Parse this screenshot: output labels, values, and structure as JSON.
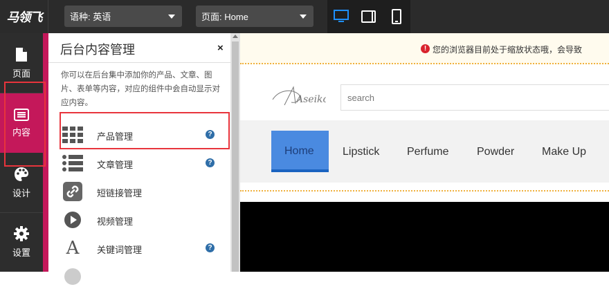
{
  "topbar": {
    "logo_text": "马领飞",
    "language_select": "语种: 英语",
    "page_select": "页面: Home",
    "devices": [
      "desktop-icon",
      "tablet-icon",
      "mobile-icon"
    ],
    "active_device": "desktop",
    "accent": "#1e90ff"
  },
  "leftnav": {
    "items": [
      {
        "label": "页面",
        "icon": "file-icon"
      },
      {
        "label": "内容",
        "icon": "list-icon",
        "active": true
      },
      {
        "label": "设计",
        "icon": "palette-icon"
      },
      {
        "label": "设置",
        "icon": "gear-icon"
      }
    ],
    "active_color": "#c4185a"
  },
  "panel": {
    "title": "后台内容管理",
    "close": "×",
    "description": "你可以在后台集中添加你的产品、文章、图片、表单等内容，对应的组件中会自动显示对应内容。",
    "items": [
      {
        "label": "产品管理",
        "icon": "grid-icon",
        "help": "?"
      },
      {
        "label": "文章管理",
        "icon": "list-icon",
        "help": "?"
      },
      {
        "label": "短链接管理",
        "icon": "link-icon"
      },
      {
        "label": "视频管理",
        "icon": "play-icon"
      },
      {
        "label": "关键词管理",
        "icon": "letter-a-icon",
        "letter": "A",
        "help": "?"
      }
    ]
  },
  "preview": {
    "notice": "您的浏览器目前处于缩放状态哦，会导致",
    "notice_icon": "!",
    "logo_text": "Aseiko",
    "search_placeholder": "search",
    "nav": [
      "Home",
      "Lipstick",
      "Perfume",
      "Powder",
      "Make Up"
    ],
    "active_nav_color": "#4a8ae0"
  }
}
